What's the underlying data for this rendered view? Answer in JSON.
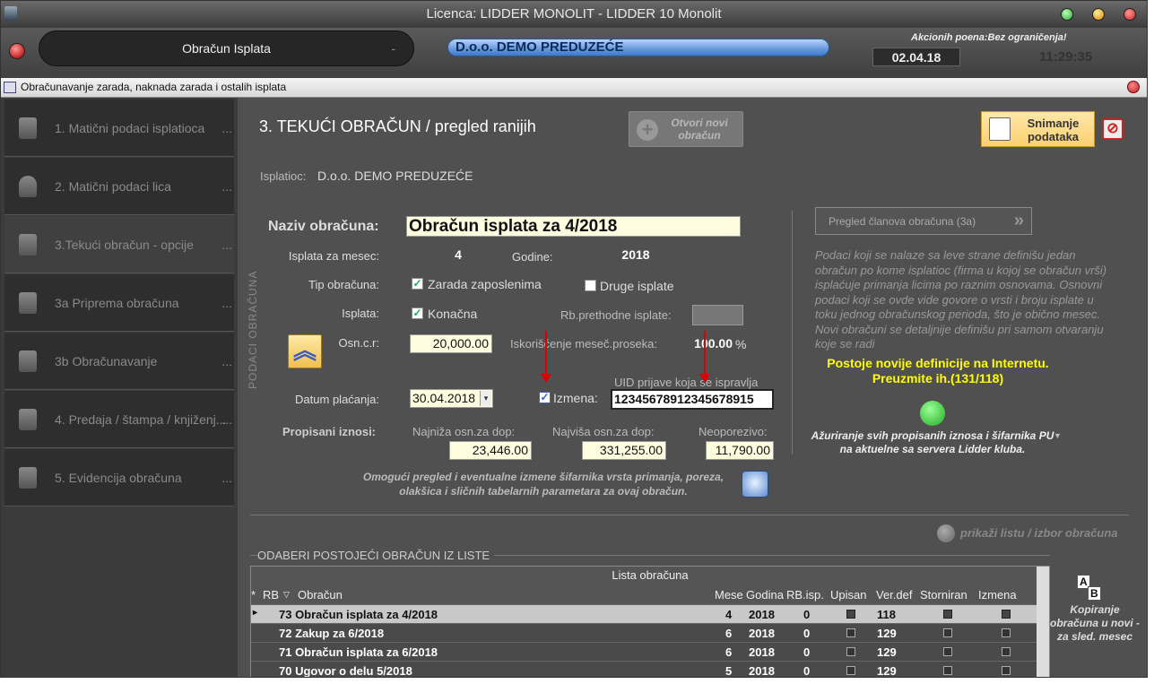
{
  "window": {
    "title": "Licenca: LIDDER MONOLIT - LIDDER 10 Monolit"
  },
  "topbar": {
    "module": "Obračun Isplata",
    "module_dash": "-",
    "company": "D.o.o. DEMO PREDUZEĆE",
    "akcionih": "Akcionih poena:Bez ograničenja!",
    "date": "02.04.18",
    "time": "11:29:35"
  },
  "subwindow": {
    "title": "Obračunavanje zarada, naknada zarada i ostalih isplata"
  },
  "sidebar": {
    "items": [
      {
        "label": "1. Matični podaci isplatioca",
        "dots": "..."
      },
      {
        "label": "2. Matični podaci lica",
        "dots": "..."
      },
      {
        "label": "3.Tekući obračun - opcije",
        "dots": "..."
      },
      {
        "label": "3a Priprema obračuna",
        "dots": "..."
      },
      {
        "label": "3b Obračunavanje",
        "dots": "..."
      },
      {
        "label": "4. Predaja / štampa / knjiženj...",
        "dots": "..."
      },
      {
        "label": "5. Evidencija obračuna",
        "dots": "..."
      }
    ]
  },
  "main": {
    "title": "3. TEKUĆI OBRAČUN / pregled ranijih",
    "btn_new": "Otvori novi obračun",
    "btn_save": "Snimanje podataka",
    "isplatioc_label": "Isplatioc:",
    "isplatioc_value": "D.o.o. DEMO PREDUZEĆE",
    "vertical": "PODACI OBRAČUNA",
    "naziv_label": "Naziv obračuna:",
    "naziv_value": "Obračun isplata za 4/2018",
    "mesec_label": "Isplata za mesec:",
    "mesec_value": "4",
    "godine_label": "Godine:",
    "godine_value": "2018",
    "tip_label": "Tip obračuna:",
    "tip_opt1": "Zarada zaposlenima",
    "tip_opt2": "Druge isplate",
    "isplata_label": "Isplata:",
    "konacna": "Konačna",
    "rb_prev_label": "Rb.prethodne isplate:",
    "osn_label": "Osn.c.r:",
    "osn_value": "20,000.00",
    "iskor_label": "Iskorišćenje meseč.proseka:",
    "iskor_value": "100.00",
    "iskor_unit": "%",
    "uid_label": "UID prijave koja se ispravlja",
    "datum_label": "Datum plaćanja:",
    "datum_value": "30.04.2018",
    "izmena_label": "Izmena:",
    "uid_value": "12345678912345678915",
    "propisani_label": "Propisani iznosi:",
    "najniza_label": "Najniža osn.za dop:",
    "najniza_value": "23,446.00",
    "najvisa_label": "Najviša osn.za dop:",
    "najvisa_value": "331,255.00",
    "neopor_label": "Neoporezivo:",
    "neopor_value": "11,790.00",
    "omoguci": "Omogući pregled i eventualne izmene šifarnika vrsta primanja, poreza, olakšica i sličnih tabelarnih parametara za ovaj obračun.",
    "btn_pregled": "Pregled članova obračuna (3a)",
    "info": "Podaci koji se nalaze sa leve strane definišu jedan obračun po kome isplatioc (firma u kojoj se obračun vrši) isplaćuje primanja licima po raznim osnovama. Osnovni podaci koji se ovde vide govore o vrsti i broju isplate u toku jednog obračunskog perioda, što je obično mesec. Novi obračuni se detaljnije definišu pri samom otvaranju koje se radi",
    "novije": "Postoje novije definicije na Internetu. Preuzmite ih.(131/118)",
    "azuriranje": "Ažuriranje svih propisanih iznosa i šifarnika PU na aktuelne sa servera Lidder kluba.",
    "prikazi": "prikaži listu / izbor obračuna",
    "odaberi": "ODABERI POSTOJEĆI OBRAČUN IZ LISTE",
    "kopiranje": "Kopiranje obračuna u novi - za sled. mesec",
    "kop_a": "A",
    "kop_b": "B"
  },
  "table": {
    "caption": "Lista obračuna",
    "headers": {
      "star": "*",
      "rb": "RB",
      "obracun": "Obračun",
      "mesec": "Mese",
      "godina": "Godina",
      "rbisp": "RB.isp.",
      "upisan": "Upisan",
      "verdef": "Ver.def",
      "storniran": "Storniran",
      "izmena": "Izmena"
    },
    "rows": [
      {
        "marker": "▸",
        "name": "73 Obračun isplata za 4/2018",
        "mesec": "4",
        "godina": "2018",
        "rbisp": "0",
        "ver": "118"
      },
      {
        "marker": "",
        "name": "72 Zakup za 6/2018",
        "mesec": "6",
        "godina": "2018",
        "rbisp": "0",
        "ver": "129"
      },
      {
        "marker": "",
        "name": "71 Obračun isplata za 6/2018",
        "mesec": "6",
        "godina": "2018",
        "rbisp": "0",
        "ver": "129"
      },
      {
        "marker": "",
        "name": "70 Ugovor o delu 5/2018",
        "mesec": "5",
        "godina": "2018",
        "rbisp": "0",
        "ver": "129"
      }
    ]
  }
}
